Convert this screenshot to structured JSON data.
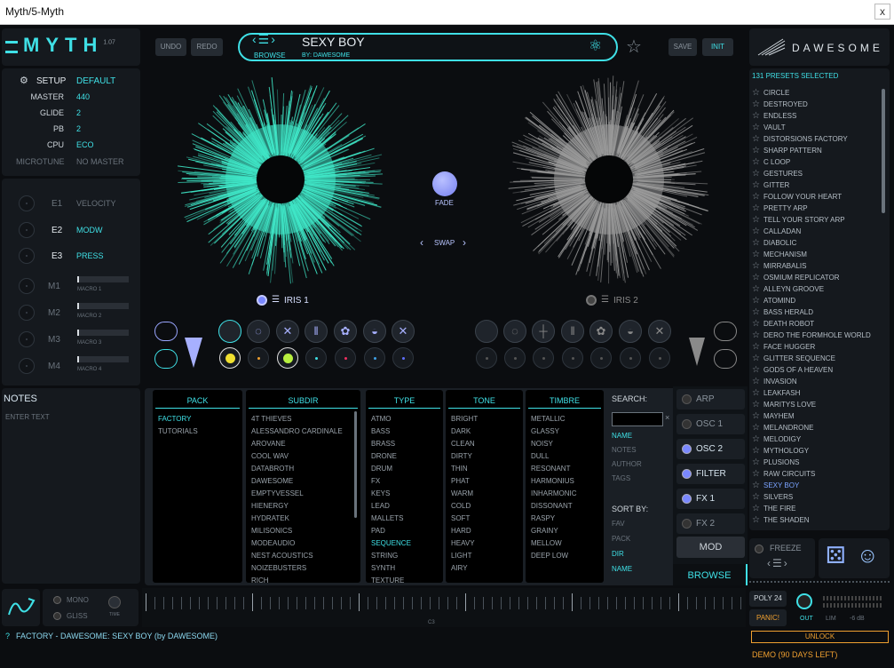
{
  "window": {
    "title": "Myth/5-Myth",
    "close": "x"
  },
  "header": {
    "logo": "MYTH",
    "version": "1.07",
    "undo": "UNDO",
    "redo": "REDO",
    "preset_name": "SEXY BOY",
    "browse": "BROWSE",
    "author": "BY: DAWESOME",
    "save": "SAVE",
    "init": "INIT",
    "brand": "DAWESOME"
  },
  "setup": {
    "title": "SETUP",
    "title_value": "DEFAULT",
    "rows": [
      {
        "label": "MASTER",
        "value": "440"
      },
      {
        "label": "GLIDE",
        "value": "2"
      },
      {
        "label": "PB",
        "value": "2"
      },
      {
        "label": "CPU",
        "value": "ECO"
      },
      {
        "label": "MICROTUNE",
        "value": "NO MASTER"
      }
    ]
  },
  "expressions": [
    {
      "label": "E1",
      "value": "VELOCITY",
      "active": false
    },
    {
      "label": "E2",
      "value": "MODW",
      "active": true
    },
    {
      "label": "E3",
      "value": "PRESS",
      "active": true
    }
  ],
  "macros": [
    {
      "label": "M1",
      "name": "MACRO 1"
    },
    {
      "label": "M2",
      "name": "MACRO 2"
    },
    {
      "label": "M3",
      "name": "MACRO 3"
    },
    {
      "label": "M4",
      "name": "MACRO 4"
    }
  ],
  "notes": {
    "title": "NOTES",
    "placeholder": "ENTER TEXT"
  },
  "center": {
    "fade": "FADE",
    "swap": "SWAP",
    "iris1": "IRIS 1",
    "iris2": "IRIS 2",
    "iris1_color": "#3fe8c8",
    "iris2_color": "#9a9a9a"
  },
  "browser": {
    "columns": [
      {
        "title": "PACK",
        "items": [
          "FACTORY",
          "TUTORIALS"
        ],
        "selected": 0
      },
      {
        "title": "SUBDIR",
        "items": [
          "4T THIEVES",
          "ALESSANDRO CARDINALE",
          "AROVANE",
          "COOL WAV",
          "DATABROTH",
          "DAWESOME",
          "EMPTYVESSEL",
          "HIENERGY",
          "HYDRATEK",
          "MILISONICS",
          "MODEAUDIO",
          "NEST ACOUSTICS",
          "NOIZEBUSTERS",
          "RICH"
        ],
        "selected": -1
      },
      {
        "title": "TYPE",
        "items": [
          "ATMO",
          "BASS",
          "BRASS",
          "DRONE",
          "DRUM",
          "FX",
          "KEYS",
          "LEAD",
          "MALLETS",
          "PAD",
          "SEQUENCE",
          "STRING",
          "SYNTH",
          "TEXTURE"
        ],
        "selected": 10
      },
      {
        "title": "TONE",
        "items": [
          "BRIGHT",
          "DARK",
          "CLEAN",
          "DIRTY",
          "THIN",
          "PHAT",
          "WARM",
          "COLD",
          "SOFT",
          "HARD",
          "HEAVY",
          "LIGHT",
          "AIRY"
        ],
        "selected": -1
      },
      {
        "title": "TIMBRE",
        "items": [
          "METALLIC",
          "GLASSY",
          "NOISY",
          "DULL",
          "RESONANT",
          "HARMONIUS",
          "INHARMONIC",
          "DISSONANT",
          "RASPY",
          "GRAINY",
          "MELLOW",
          "DEEP LOW"
        ],
        "selected": -1
      }
    ],
    "search": {
      "label": "SEARCH:",
      "value": "",
      "options": [
        "NAME",
        "NOTES",
        "AUTHOR",
        "TAGS"
      ],
      "active": 0
    },
    "sortby": {
      "label": "SORT BY:",
      "options": [
        "FAV",
        "PACK",
        "DIR",
        "NAME"
      ],
      "active": [
        2,
        3
      ]
    }
  },
  "sections": [
    {
      "label": "ARP",
      "on": false
    },
    {
      "label": "OSC 1",
      "on": false
    },
    {
      "label": "OSC 2",
      "on": true
    },
    {
      "label": "FILTER",
      "on": true
    },
    {
      "label": "FX 1",
      "on": true
    },
    {
      "label": "FX 2",
      "on": false
    }
  ],
  "mod": "MOD",
  "browse_tab": "BROWSE",
  "presets": {
    "header": "131 PRESETS SELECTED",
    "items": [
      "CIRCLE",
      "DESTROYED",
      "ENDLESS",
      "VAULT",
      "DISTORSIONS FACTORY",
      "SHARP PATTERN",
      "C LOOP",
      "GESTURES",
      "GITTER",
      "FOLLOW YOUR HEART",
      "PRETTY ARP",
      "TELL YOUR STORY ARP",
      "CALLADAN",
      "DIABOLIC",
      "MECHANISM",
      "MIRRABALIS",
      "OSMIUM REPLICATOR",
      "ALLEYN GROOVE",
      "ATOMIND",
      "BASS HERALD",
      "DEATH ROBOT",
      "DERO THE FORMHOLE WORLD",
      "FACE HUGGER",
      "GLITTER SEQUENCE",
      "GODS OF A HEAVEN",
      "INVASION",
      "LEAKFASH",
      "MARITYS LOVE",
      "MAYHEM",
      "MELANDRONE",
      "MELODIGY",
      "MYTHOLOGY",
      "PLUSIONS",
      "RAW CIRCUITS",
      "SEXY BOY",
      "SILVERS",
      "THE FIRE",
      "THE SHADEN"
    ],
    "selected": 34
  },
  "freeze": "FREEZE",
  "bottom": {
    "mono": "MONO",
    "gliss": "GLISS",
    "time": "TIME",
    "c3": "C3",
    "poly": "POLY 24",
    "panic": "PANIC!",
    "out": "OUT",
    "lim": "LIM",
    "db": "-6 dB",
    "status_q": "?",
    "status": "FACTORY - DAWESOME:  SEXY BOY (by DAWESOME)",
    "unlock": "UNLOCK",
    "demo": "DEMO (90 DAYS LEFT)"
  }
}
